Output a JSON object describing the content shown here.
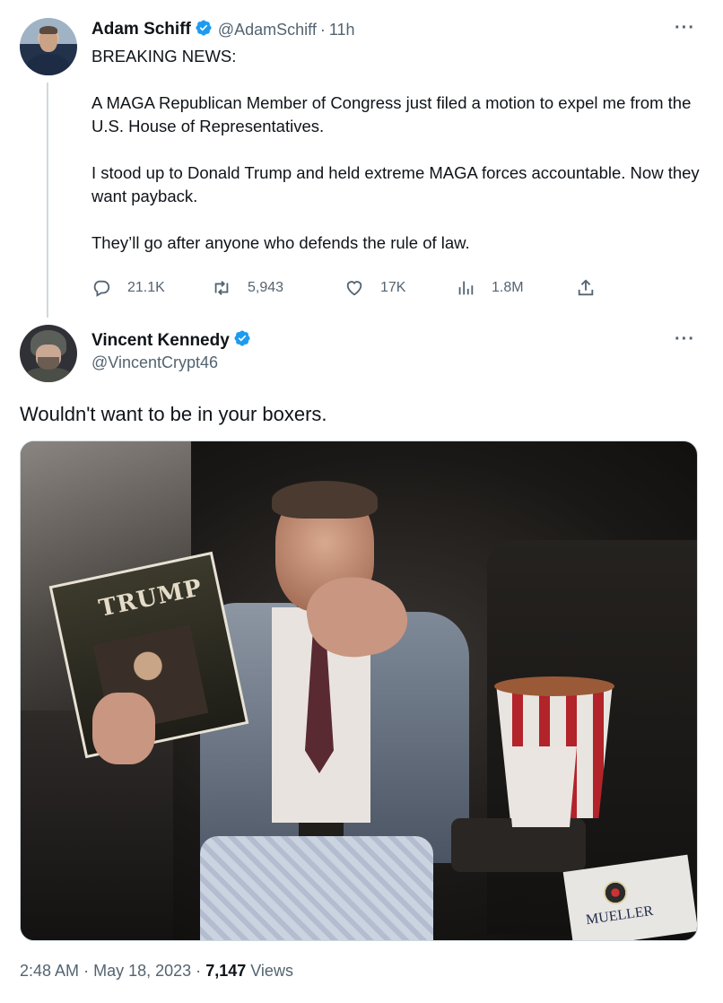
{
  "tweet": {
    "author": {
      "name": "Adam Schiff",
      "handle": "@AdamSchiff",
      "time": "11h",
      "separator": "·"
    },
    "text": [
      "BREAKING NEWS:",
      "A MAGA Republican Member of Congress just filed a motion to expel me from the U.S. House of Representatives.",
      "I stood up to Donald Trump and held extreme MAGA forces accountable. Now they want payback.",
      "They’ll go after anyone who defends the rule of law."
    ],
    "stats": {
      "replies": "21.1K",
      "retweets": "5,943",
      "likes": "17K",
      "views": "1.8M"
    },
    "more_label": "···"
  },
  "reply": {
    "author": {
      "name": "Vincent Kennedy",
      "handle": "@VincentCrypt46"
    },
    "text": "Wouldn't want to be in your boxers.",
    "more_label": "···",
    "media": {
      "book_title": "TRUMP",
      "box_label": "MUELLER"
    },
    "footer": {
      "time": "2:48 AM",
      "date": "May 18, 2023",
      "separator": "·",
      "views_count": "7,147",
      "views_label": "Views"
    }
  },
  "colors": {
    "accent": "#1d9bf0",
    "text": "#0f1419",
    "secondary": "#536471",
    "line": "#cfd9de"
  },
  "icons": [
    "verified-badge-icon",
    "more-icon",
    "reply-icon",
    "retweet-icon",
    "like-icon",
    "views-icon",
    "share-icon"
  ]
}
